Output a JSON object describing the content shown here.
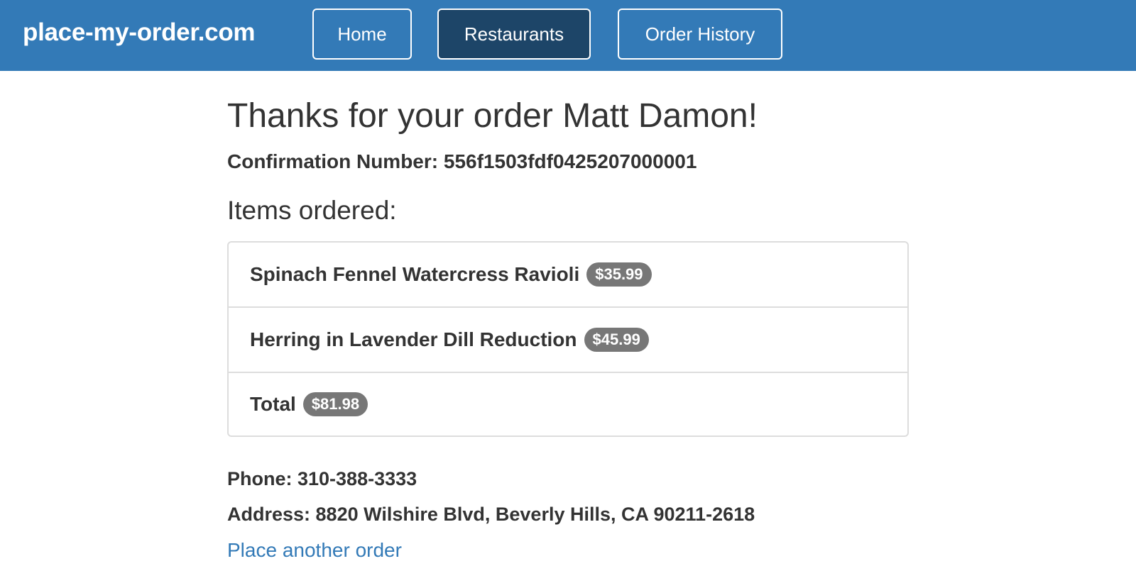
{
  "navbar": {
    "brand": "place-my-order.com",
    "items": [
      {
        "label": "Home",
        "active": false
      },
      {
        "label": "Restaurants",
        "active": true
      },
      {
        "label": "Order History",
        "active": false
      }
    ],
    "colors": {
      "background": "#337ab7",
      "active": "#1d4568"
    }
  },
  "order": {
    "title": "Thanks for your order Matt Damon!",
    "confirmation_label": "Confirmation Number: 556f1503fdf0425207000001",
    "items_heading": "Items ordered:",
    "items": [
      {
        "name": "Spinach Fennel Watercress Ravioli",
        "price": "$35.99"
      },
      {
        "name": "Herring in Lavender Dill Reduction",
        "price": "$45.99"
      }
    ],
    "total_label": "Total",
    "total_price": "$81.98",
    "phone": "Phone: 310-388-3333",
    "address": "Address: 8820 Wilshire Blvd, Beverly Hills, CA 90211-2618",
    "place_another_link": "Place another order"
  }
}
